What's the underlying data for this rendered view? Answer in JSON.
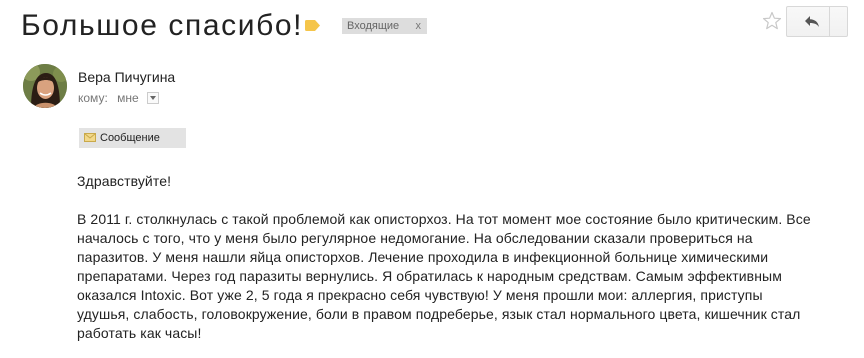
{
  "email": {
    "subject": "Большое спасибо!",
    "label": "Входящие",
    "label_remove": "x",
    "sender_name": "Вера Пичугина",
    "recipient_prefix": "кому:",
    "recipient_value": "мне",
    "message_tab_label": "Сообщение",
    "greeting": "Здравствуйте!",
    "body_lines": [
      "В 2011 г. столкнулась с такой проблемой как описторхоз. На тот момент мое состояние было критическим. Все",
      "началось с того, что у меня было регулярное недомогание. На обследовании сказали провериться на",
      "паразитов. У меня нашли яйца описторхов. Лечение проходила в инфекционной больнице химическими",
      "препаратами. Через год паразиты вернулись. Я обратилась к народным средствам. Самым эффективным",
      "оказался Intoxic. Вот уже 2, 5 года я прекрасно себя чувствую! У меня прошли мои: аллергия, приступы",
      "удушья, слабость, головокружение, боли в правом подреберье, язык стал нормального цвета, кишечник стал",
      "работать как часы!"
    ]
  },
  "icons": {
    "label_tag": "label-tag-icon",
    "star": "star-icon",
    "reply": "reply-icon",
    "envelope": "envelope-icon",
    "dropdown": "chevron-down-icon"
  },
  "colors": {
    "label_tag": "#f5c54a",
    "chip_bg": "#dddddd",
    "tab_bg": "#e3e3e3",
    "text": "#222222",
    "muted": "#777777"
  }
}
